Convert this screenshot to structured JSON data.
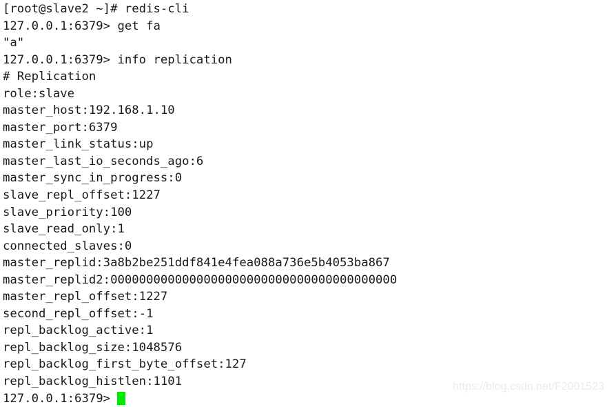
{
  "terminal": {
    "app": "redis-cli",
    "background_color": "#ffffff",
    "text_color": "#1a1a1a",
    "cursor_color": "#00e800",
    "lines": [
      "[root@slave2 ~]# redis-cli",
      "127.0.0.1:6379> get fa",
      "\"a\"",
      "127.0.0.1:6379> info replication",
      "# Replication",
      "role:slave",
      "master_host:192.168.1.10",
      "master_port:6379",
      "master_link_status:up",
      "master_last_io_seconds_ago:6",
      "master_sync_in_progress:0",
      "slave_repl_offset:1227",
      "slave_priority:100",
      "slave_read_only:1",
      "connected_slaves:0",
      "master_replid:3a8b2be251ddf841e4fea088a736e5b4053ba867",
      "master_replid2:0000000000000000000000000000000000000000",
      "master_repl_offset:1227",
      "second_repl_offset:-1",
      "repl_backlog_active:1",
      "repl_backlog_size:1048576",
      "repl_backlog_first_byte_offset:127",
      "repl_backlog_histlen:1101"
    ],
    "final_prompt": "127.0.0.1:6379>"
  },
  "watermark": {
    "text": "https://blog.csdn.net/F2001523"
  }
}
